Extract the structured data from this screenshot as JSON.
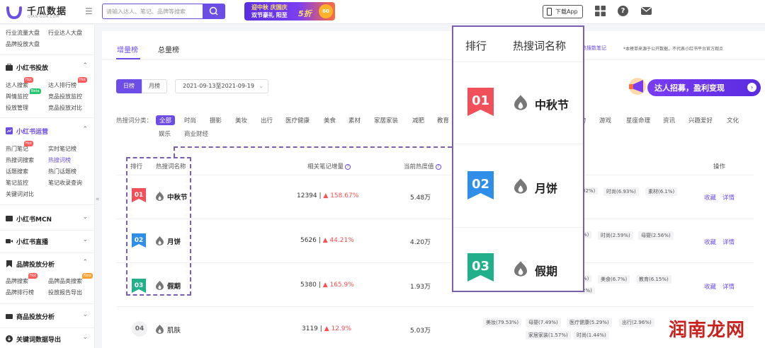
{
  "header": {
    "logo_name": "千瓜数据",
    "logo_sub": "QIAN-GUA.COM",
    "search_placeholder": "请输入达人、笔记、品牌等搜索",
    "promo_line1": "迎中秋 庆国庆",
    "promo_line2": "双节豪礼 阳至",
    "promo_discount": "5折",
    "promo_badge": "60",
    "download_app": "下载App"
  },
  "sidebar": {
    "top_links": [
      "行业流量大盘",
      "行业达人大盘",
      "品牌投放大盘"
    ],
    "sections": [
      {
        "label": "小红书投放",
        "items": [
          "达人搜索",
          "达人排行榜",
          "舆情监控",
          "竞品投放监控",
          "投放管理",
          "竞品投放对比"
        ],
        "tags": [
          "Hot",
          "Hot",
          "Beta"
        ]
      },
      {
        "label": "小红书运营",
        "items": [
          "热门笔记",
          "实时笔记榜",
          "热搜词搜索",
          "热搜词榜",
          "话题搜索",
          "热门话题榜",
          "笔记监控",
          "笔记收录查询",
          "关键词对比"
        ],
        "tags": [
          "Hot"
        ]
      },
      {
        "label": "小红书MCN"
      },
      {
        "label": "小红书直播"
      },
      {
        "label": "品牌投放分析",
        "items": [
          "品牌搜索",
          "品牌品类搜索",
          "品牌排行榜",
          "投放报告导出"
        ],
        "tags": [
          "Hot",
          "New"
        ]
      },
      {
        "label": "商品投放分析"
      },
      {
        "label": "关键词数据导出"
      }
    ],
    "fold": "«"
  },
  "main": {
    "tabs": [
      "增量榜",
      "总量榜"
    ],
    "mid_link": "热搜数笔记",
    "right_note": "*本榜单来源于公开数据，不代表小红书平台官方观点",
    "period_day": "日榜",
    "period_month": "月榜",
    "date_range": "2021-09-13至2021-09-19",
    "banner_text": "达人招募，盈利变现",
    "category_label": "热搜词分类：",
    "categories_row1": [
      "全部",
      "时尚",
      "摄影",
      "美妆",
      "出行",
      "医疗健康",
      "美食",
      "素材",
      "家居家装",
      "减肥",
      "教育"
    ],
    "categories_row1_right": [
      "宠物",
      "游戏",
      "星座命理",
      "资讯",
      "兴趣爱好",
      "文化"
    ],
    "categories_row2": [
      "娱乐",
      "商业财经"
    ],
    "columns": {
      "rank": "排行",
      "keyword": "热搜词名称",
      "increment": "相关笔记增量",
      "heat": "当前热度值",
      "ops": "操作"
    },
    "rows": [
      {
        "rank": "01",
        "keyword": "中秋节",
        "increment": "12394 |",
        "pct": "158.67%",
        "heat": "5.48万",
        "tags": [
          "02%)",
          "时尚(6.93%)",
          "素材(6.1%)"
        ],
        "ops": [
          "收藏",
          "详情"
        ]
      },
      {
        "rank": "02",
        "keyword": "月饼",
        "increment": "5626 |",
        "pct": "44.21%",
        "heat": "4.20万",
        "tags": [
          "%)",
          "时尚(2.59%)",
          "母婴(2.56%)"
        ],
        "ops": [
          "收藏",
          "详情"
        ]
      },
      {
        "rank": "03",
        "keyword": "假期",
        "increment": "5380 |",
        "pct": "165.9%",
        "heat": "1.93万",
        "tags": [
          "%)",
          "美食(6.7%)",
          "教育(6.15%)",
          "2%)"
        ],
        "ops": [
          "收藏",
          "详情"
        ]
      },
      {
        "rank": "04",
        "keyword": "肌肤",
        "increment": "3119 |",
        "pct": "12.9%",
        "heat": "5.03万",
        "tags": [
          "美妆(79.53%)",
          "母婴(7.49%)",
          "医疗健康(5.29%)",
          "出行(2.96%)",
          "家居家装(1.57%)",
          "时尚(1.44%)"
        ],
        "ops": [
          "收藏",
          "详情"
        ]
      }
    ]
  },
  "zoom": {
    "rank_header": "排行",
    "name_header": "热搜词名称",
    "rows": [
      {
        "rank": "01",
        "keyword": "中秋节"
      },
      {
        "rank": "02",
        "keyword": "月饼"
      },
      {
        "rank": "03",
        "keyword": "假期"
      }
    ]
  },
  "watermark": "润南龙网",
  "colors": {
    "accent": "#6c4de6",
    "rank1": "#f0505a",
    "rank2": "#2e8ee8",
    "rank3": "#22b08a",
    "up": "#ff4d4f"
  },
  "icons": {
    "search": "search-icon",
    "grid": "grid-icon",
    "help": "help-icon",
    "mail": "mail-icon",
    "flame": "flame-icon",
    "phone": "phone-icon"
  }
}
